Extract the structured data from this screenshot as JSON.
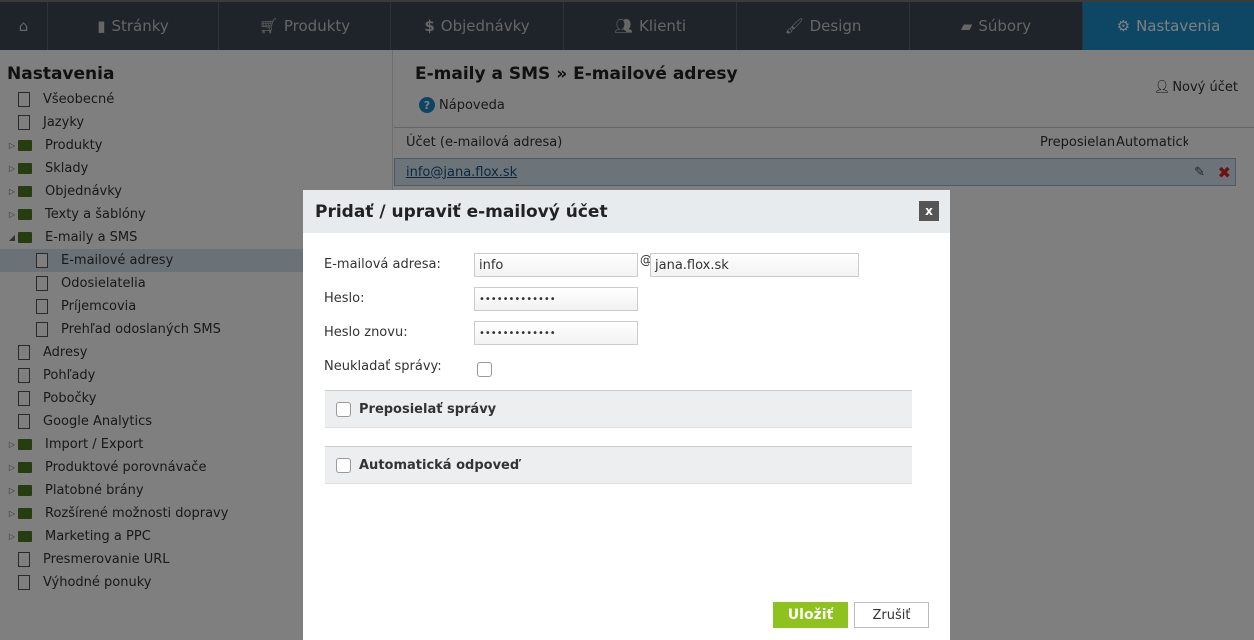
{
  "nav": {
    "tabs": [
      {
        "label": "",
        "icon": "home-icon"
      },
      {
        "label": "Stránky",
        "icon": "page-icon"
      },
      {
        "label": "Produkty",
        "icon": "cart-icon"
      },
      {
        "label": "Objednávky",
        "icon": "dollar-icon"
      },
      {
        "label": "Klienti",
        "icon": "users-icon"
      },
      {
        "label": "Design",
        "icon": "brush-icon"
      },
      {
        "label": "Súbory",
        "icon": "folder-icon"
      },
      {
        "label": "Nastavenia",
        "icon": "gear-icon",
        "active": true
      }
    ]
  },
  "sidebar": {
    "title": "Nastavenia",
    "items": [
      {
        "label": "Všeobecné",
        "type": "page",
        "level": 0
      },
      {
        "label": "Jazyky",
        "type": "page",
        "level": 0
      },
      {
        "label": "Produkty",
        "type": "folder",
        "level": 0
      },
      {
        "label": "Sklady",
        "type": "folder",
        "level": 0
      },
      {
        "label": "Objednávky",
        "type": "folder",
        "level": 0
      },
      {
        "label": "Texty a šablóny",
        "type": "folder",
        "level": 0
      },
      {
        "label": "E-maily a SMS",
        "type": "folder",
        "level": 0,
        "expanded": true
      },
      {
        "label": "E-mailové adresy",
        "type": "page",
        "level": 1,
        "selected": true
      },
      {
        "label": "Odosielatelia",
        "type": "page",
        "level": 1
      },
      {
        "label": "Príjemcovia",
        "type": "page",
        "level": 1
      },
      {
        "label": "Prehľad odoslaných SMS",
        "type": "page",
        "level": 1
      },
      {
        "label": "Adresy",
        "type": "page",
        "level": 0
      },
      {
        "label": "Pohľady",
        "type": "page",
        "level": 0
      },
      {
        "label": "Pobočky",
        "type": "page",
        "level": 0
      },
      {
        "label": "Google Analytics",
        "type": "page",
        "level": 0
      },
      {
        "label": "Import / Export",
        "type": "folder",
        "level": 0
      },
      {
        "label": "Produktové porovnávače",
        "type": "folder",
        "level": 0
      },
      {
        "label": "Platobné brány",
        "type": "folder",
        "level": 0
      },
      {
        "label": "Rozšírené možnosti dopravy",
        "type": "folder",
        "level": 0
      },
      {
        "label": "Marketing a PPC",
        "type": "folder",
        "level": 0
      },
      {
        "label": "Presmerovanie URL",
        "type": "page",
        "level": 0
      },
      {
        "label": "Výhodné ponuky",
        "type": "page",
        "level": 0
      }
    ]
  },
  "main": {
    "title": "E-maily a SMS » E-mailové adresy",
    "help": "Nápoveda",
    "new_account": "Nový účet",
    "columns": [
      "Účet (e-mailová adresa)",
      "Preposielan",
      "Automatická"
    ],
    "rows": [
      {
        "account": "info@jana.flox.sk"
      }
    ]
  },
  "modal": {
    "title": "Pridať / upraviť e-mailový účet",
    "close": "x",
    "email_label": "E-mailová adresa:",
    "email_user": "info",
    "at": "@",
    "email_domain": "jana.flox.sk",
    "password_label": "Heslo:",
    "password": "•••••••••••••",
    "password2_label": "Heslo znovu:",
    "password2": "•••••••••••••",
    "nosave_label": "Neukladať správy:",
    "nosave_checked": false,
    "forward_label": "Preposielať správy",
    "forward_checked": false,
    "autoreply_label": "Automatická odpoveď",
    "autoreply_checked": false,
    "save": "Uložiť",
    "cancel": "Zrušiť"
  },
  "colors": {
    "accent": "#1a8fc8",
    "save": "#8dc21f"
  }
}
